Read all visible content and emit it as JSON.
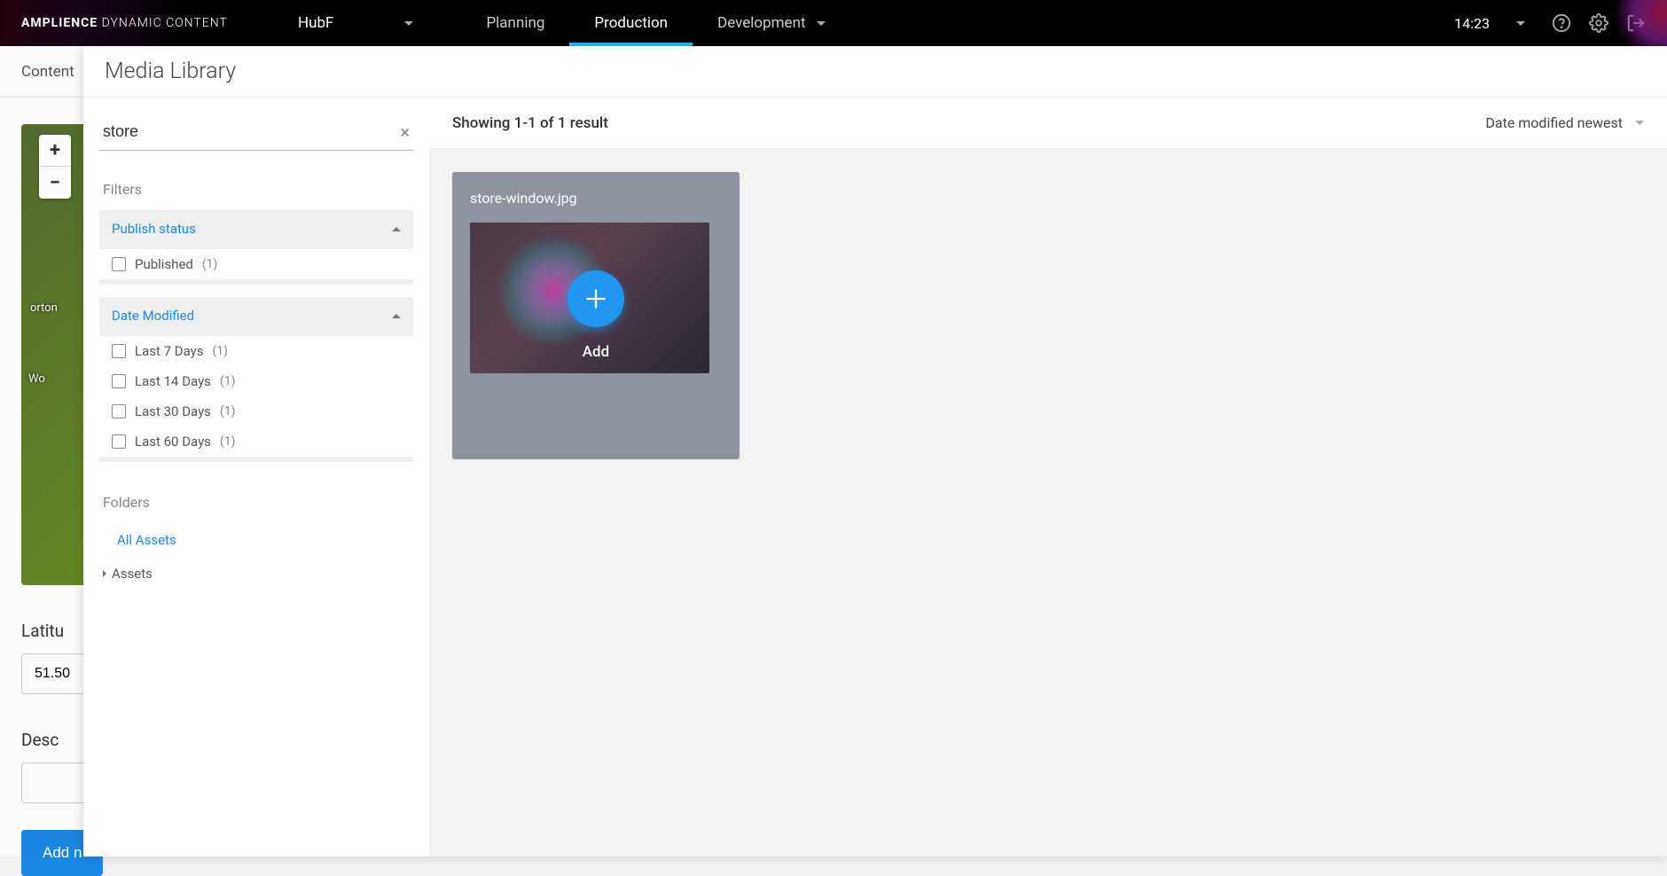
{
  "header": {
    "logo_text_a": "AMPLIENCE",
    "logo_text_b": "DYNAMIC CONTENT",
    "hub": "HubF",
    "nav": [
      "Planning",
      "Production",
      "Development"
    ],
    "active_nav": "Production",
    "time": "14:23"
  },
  "secondary": {
    "tab_label": "Content"
  },
  "page": {
    "map_labels": [
      "orton",
      "Wo"
    ],
    "zoom_in": "+",
    "zoom_out": "−",
    "latitude_label": "Latitu",
    "latitude_value": "51.50",
    "description_label": "Desc",
    "add_button": "Add n"
  },
  "media_library": {
    "title": "Media Library",
    "search": {
      "value": "store",
      "clear": "×"
    },
    "filters_heading": "Filters",
    "sections": [
      {
        "title": "Publish status",
        "options": [
          {
            "label": "Published",
            "count": "(1)"
          }
        ]
      },
      {
        "title": "Date Modified",
        "options": [
          {
            "label": "Last 7 Days",
            "count": "(1)"
          },
          {
            "label": "Last 14 Days",
            "count": "(1)"
          },
          {
            "label": "Last 30 Days",
            "count": "(1)"
          },
          {
            "label": "Last 60 Days",
            "count": "(1)"
          }
        ]
      }
    ],
    "folders_heading": "Folders",
    "all_assets": "All Assets",
    "assets": "Assets",
    "results": {
      "showing": "Showing 1-1 of 1 result",
      "sort": "Date modified newest",
      "items": [
        {
          "filename": "store-window.jpg",
          "add_label": "Add"
        }
      ]
    }
  }
}
